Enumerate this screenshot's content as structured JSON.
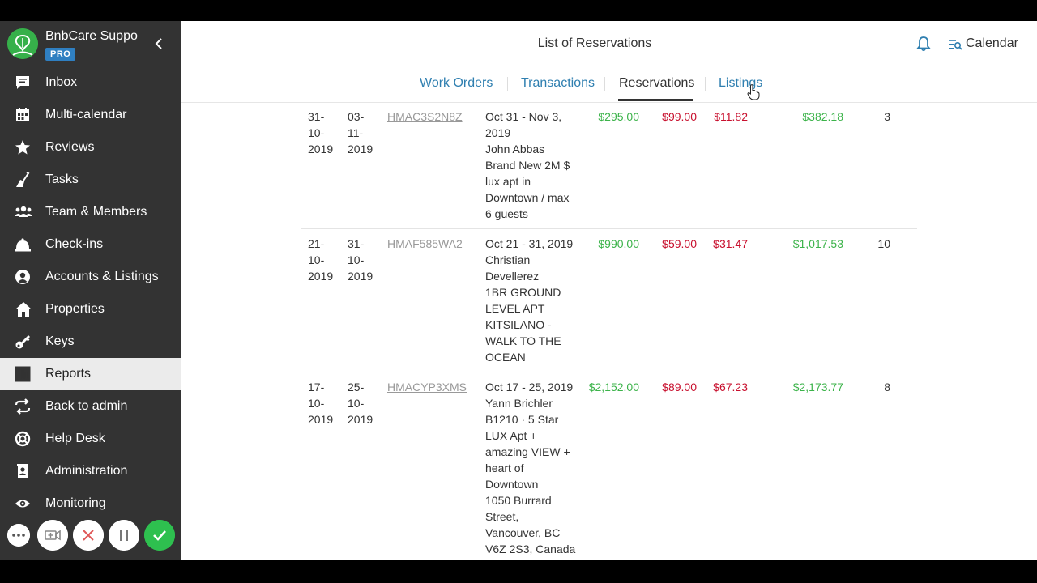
{
  "sidebar": {
    "brand_name": "BnbCare Suppo",
    "badge": "PRO",
    "items": [
      {
        "label": "Inbox",
        "icon": "inbox-icon"
      },
      {
        "label": "Multi-calendar",
        "icon": "calendar-icon"
      },
      {
        "label": "Reviews",
        "icon": "star-icon"
      },
      {
        "label": "Tasks",
        "icon": "broom-icon"
      },
      {
        "label": "Team & Members",
        "icon": "team-icon"
      },
      {
        "label": "Check-ins",
        "icon": "bell-desk-icon"
      },
      {
        "label": "Accounts & Listings",
        "icon": "account-icon"
      },
      {
        "label": "Properties",
        "icon": "home-icon"
      },
      {
        "label": "Keys",
        "icon": "key-icon"
      },
      {
        "label": "Reports",
        "icon": "chart-icon",
        "active": true
      },
      {
        "label": "Back to admin",
        "icon": "swap-icon"
      },
      {
        "label": "Help Desk",
        "icon": "lifebuoy-icon"
      },
      {
        "label": "Administration",
        "icon": "admin-icon"
      },
      {
        "label": "Monitoring",
        "icon": "eye-icon"
      }
    ]
  },
  "header": {
    "title": "List of Reservations",
    "calendar_label": "Calendar"
  },
  "tabs": [
    {
      "label": "Work Orders"
    },
    {
      "label": "Transactions"
    },
    {
      "label": "Reservations",
      "active": true
    },
    {
      "label": "Listings"
    }
  ],
  "colors": {
    "sidebar_bg": "#333333",
    "accent_blue": "#2f7fb0",
    "positive_green": "#3cb34a",
    "negative_red": "#c8102e",
    "brand_green": "#36b04a"
  },
  "rows": [
    {
      "from_lines": [
        "31-",
        "10-",
        "2019"
      ],
      "to_lines": [
        "03-",
        "11-",
        "2019"
      ],
      "code": "HMAC3S2N8Z",
      "desc_lines": [
        "Oct 31 - Nov 3,",
        "2019",
        "John Abbas",
        "Brand New 2M $",
        "lux apt in",
        "Downtown / max",
        "6 guests"
      ],
      "gross": "$295.00",
      "fee": "$99.00",
      "tax": "$11.82",
      "total": "$382.18",
      "nights": "3"
    },
    {
      "from_lines": [
        "21-",
        "10-",
        "2019"
      ],
      "to_lines": [
        "31-",
        "10-",
        "2019"
      ],
      "code": "HMAF585WA2",
      "desc_lines": [
        "Oct 21 - 31, 2019",
        "Christian",
        "Devellerez",
        "1BR GROUND",
        "LEVEL APT",
        "KITSILANO -",
        "WALK TO THE",
        "OCEAN"
      ],
      "gross": "$990.00",
      "fee": "$59.00",
      "tax": "$31.47",
      "total": "$1,017.53",
      "nights": "10"
    },
    {
      "from_lines": [
        "17-",
        "10-",
        "2019"
      ],
      "to_lines": [
        "25-",
        "10-",
        "2019"
      ],
      "code": "HMACYP3XMS",
      "desc_lines": [
        "Oct 17 - 25, 2019",
        "Yann Brichler",
        "B1210 · 5 Star",
        "LUX Apt +",
        "amazing VIEW +",
        "heart of",
        "Downtown",
        "1050 Burrard",
        "Street,",
        "Vancouver, BC",
        "V6Z 2S3, Canada"
      ],
      "gross": "$2,152.00",
      "fee": "$89.00",
      "tax": "$67.23",
      "total": "$2,173.77",
      "nights": "8"
    }
  ]
}
